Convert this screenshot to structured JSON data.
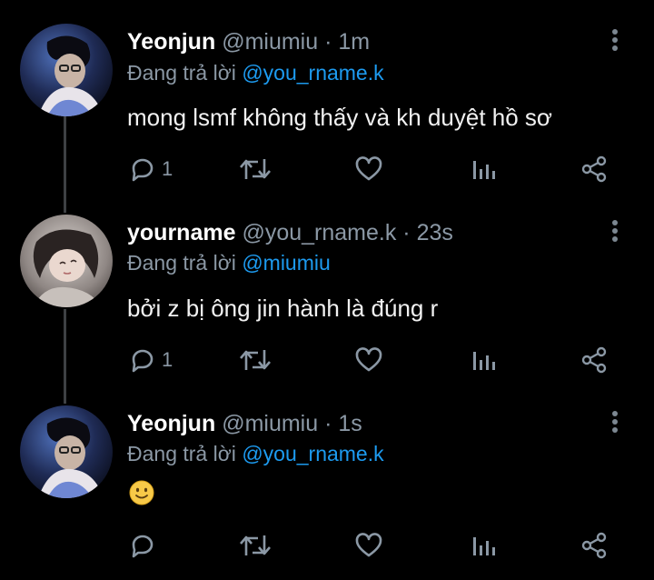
{
  "tweets": [
    {
      "name": "Yeonjun",
      "handle": "@miumiu",
      "separator": "·",
      "time": "1m",
      "reply_prefix": "Đang trả lời",
      "reply_to": "@you_rname.k",
      "text": "mong lsmf không thấy và kh duyệt hồ sơ",
      "reply_count": "1",
      "avatar": "yeonjun-avatar"
    },
    {
      "name": "yourname",
      "handle": "@you_rname.k",
      "separator": "·",
      "time": "23s",
      "reply_prefix": "Đang trả lời",
      "reply_to": "@miumiu",
      "text": "bởi z bị ông jin hành là đúng r",
      "reply_count": "1",
      "avatar": "yourname-avatar"
    },
    {
      "name": "Yeonjun",
      "handle": "@miumiu",
      "separator": "·",
      "time": "1s",
      "reply_prefix": "Đang trả lời",
      "reply_to": "@you_rname.k",
      "text": "🙂",
      "reply_count": "",
      "avatar": "yeonjun-avatar"
    }
  ],
  "colors": {
    "background": "#000000",
    "name": "#ffffff",
    "muted": "#8b98a5",
    "link": "#1d9bf0",
    "thread_line": "#3e4144"
  },
  "icons": [
    "reply-icon",
    "retweet-icon",
    "like-icon",
    "views-icon",
    "share-icon",
    "more-icon",
    "emoji-slightly-smiling"
  ]
}
